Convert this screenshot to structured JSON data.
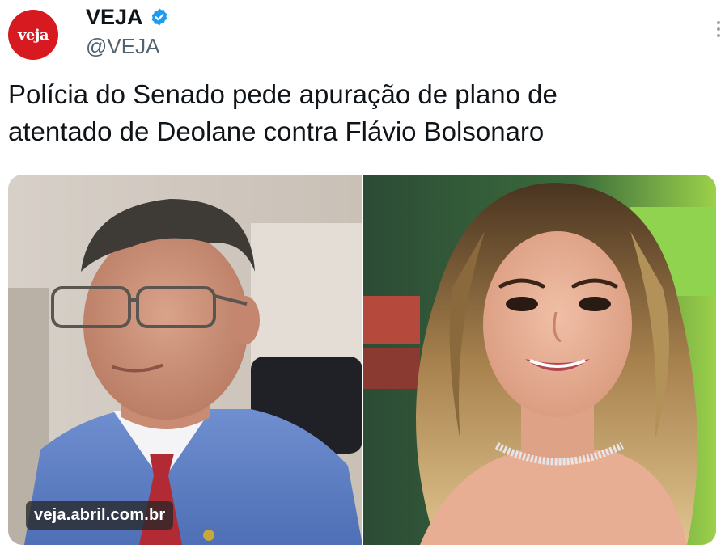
{
  "tweet": {
    "avatar_text": "veja",
    "display_name": "VEJA",
    "verified_icon": "verified-badge-icon",
    "handle": "@VEJA",
    "text_line1": "Polícia do Senado pede apuração de plano de",
    "text_line2": "atentado de Deolane contra Flávio Bolsonaro",
    "more_icon": "more-options-icon"
  },
  "media": {
    "watermark": "veja.abril.com.br"
  },
  "colors": {
    "brand_red": "#d71920",
    "verified_blue": "#1d9bf0",
    "handle_gray": "#536471"
  }
}
